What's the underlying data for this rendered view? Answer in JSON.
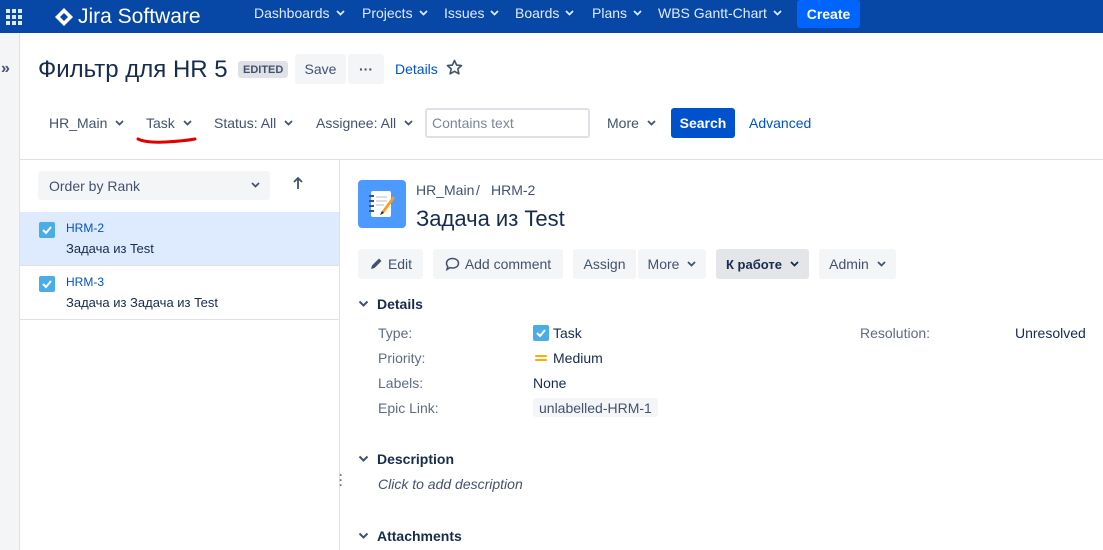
{
  "topnav": {
    "logo": "Jira Software",
    "items": [
      "Dashboards",
      "Projects",
      "Issues",
      "Boards",
      "Plans",
      "WBS Gantt-Chart"
    ],
    "create": "Create"
  },
  "header": {
    "title": "Фильтр для HR 5",
    "edited": "EDITED",
    "save": "Save",
    "more": "···",
    "details": "Details"
  },
  "filters": {
    "project": "HR_Main",
    "type": "Task",
    "status": "Status: All",
    "assignee": "Assignee: All",
    "search_placeholder": "Contains text",
    "more": "More",
    "search": "Search",
    "advanced": "Advanced"
  },
  "list": {
    "order": "Order by Rank",
    "issues": [
      {
        "key": "HRM-2",
        "summary": "Задача из Test"
      },
      {
        "key": "HRM-3",
        "summary": "Задача из Задача из Test"
      }
    ]
  },
  "issue": {
    "project": "HR_Main",
    "key": "HRM-2",
    "title": "Задача из Test",
    "actions": {
      "edit": "Edit",
      "comment": "Add comment",
      "assign": "Assign",
      "more": "More",
      "workflow": "К работе",
      "admin": "Admin"
    },
    "details_header": "Details",
    "fields": {
      "type_label": "Type:",
      "type_value": "Task",
      "priority_label": "Priority:",
      "priority_value": "Medium",
      "labels_label": "Labels:",
      "labels_value": "None",
      "epic_label": "Epic Link:",
      "epic_value": "unlabelled-HRM-1",
      "resolution_label": "Resolution:",
      "resolution_value": "Unresolved"
    },
    "description_header": "Description",
    "description_placeholder": "Click to add description",
    "attachments_header": "Attachments"
  },
  "colors": {
    "nav": "#0747a6",
    "primary": "#0052cc",
    "create": "#0065ff",
    "selected_row": "#deebff",
    "annotation": "#e00000",
    "priority_medium": "#ffab00"
  }
}
